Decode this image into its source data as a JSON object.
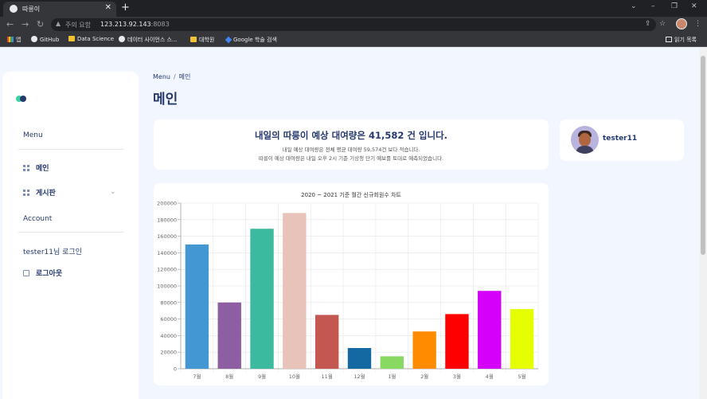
{
  "browser": {
    "tab_title": "따릉이",
    "tab_close": "✕",
    "new_tab": "+",
    "security_label": "주의 요함",
    "url_host": "123.213.92.143",
    "url_port": ":8083",
    "bookmarks": [
      {
        "label": "앱",
        "icon": "apps-icon"
      },
      {
        "label": "GitHub",
        "icon": "github-icon"
      },
      {
        "label": "Data Science",
        "icon": "folder-icon"
      },
      {
        "label": "데이터 사이언스 스...",
        "icon": "globe-icon"
      },
      {
        "label": "대학원",
        "icon": "folder-icon"
      },
      {
        "label": "Google 학술 검색",
        "icon": "scholar-icon"
      }
    ],
    "reading_list": "읽기 목록"
  },
  "sidebar": {
    "menu_title": "Menu",
    "items": [
      {
        "label": "메인",
        "icon": "grid-icon"
      },
      {
        "label": "게시판",
        "icon": "grid-icon"
      }
    ],
    "account_title": "Account",
    "login_text": "tester11님 로그인",
    "logout_label": "로그아웃"
  },
  "breadcrumb": {
    "root": "Menu",
    "sep": "/",
    "current": "메인"
  },
  "page_title": "메인",
  "forecast": {
    "title": "내일의 따릉이 예상 대여량은 41,582 건 입니다.",
    "line1": "내일 예상 대여량은 전체 평균 대여량 59,574건 보다 적습니다.",
    "line2": "따릉이 예상 대여량은 내일 오후 2시 기준 기상청 단기 예보를 토대로 예측되었습니다."
  },
  "profile": {
    "username": "tester11"
  },
  "chart_data": {
    "type": "bar",
    "title": "2020 ~ 2021 기준 월간 신규회원수 차트",
    "categories": [
      "7월",
      "8월",
      "9월",
      "10월",
      "11월",
      "12월",
      "1월",
      "2월",
      "3월",
      "4월",
      "5월"
    ],
    "values": [
      150000,
      80000,
      169000,
      188000,
      65000,
      25000,
      15000,
      45000,
      66000,
      94000,
      72000
    ],
    "colors": [
      "#4398d3",
      "#8e5ea2",
      "#3cba9f",
      "#e8c3b9",
      "#c45850",
      "#1569a3",
      "#88d962",
      "#ff8c00",
      "#ff0000",
      "#d500f9",
      "#e6ff00"
    ],
    "ylim": [
      0,
      200000
    ],
    "yticks": [
      "0",
      "20000",
      "40000",
      "60000",
      "80000",
      "100000",
      "120000",
      "140000",
      "160000",
      "180000",
      "200000"
    ],
    "grid": true,
    "legend": "none"
  }
}
